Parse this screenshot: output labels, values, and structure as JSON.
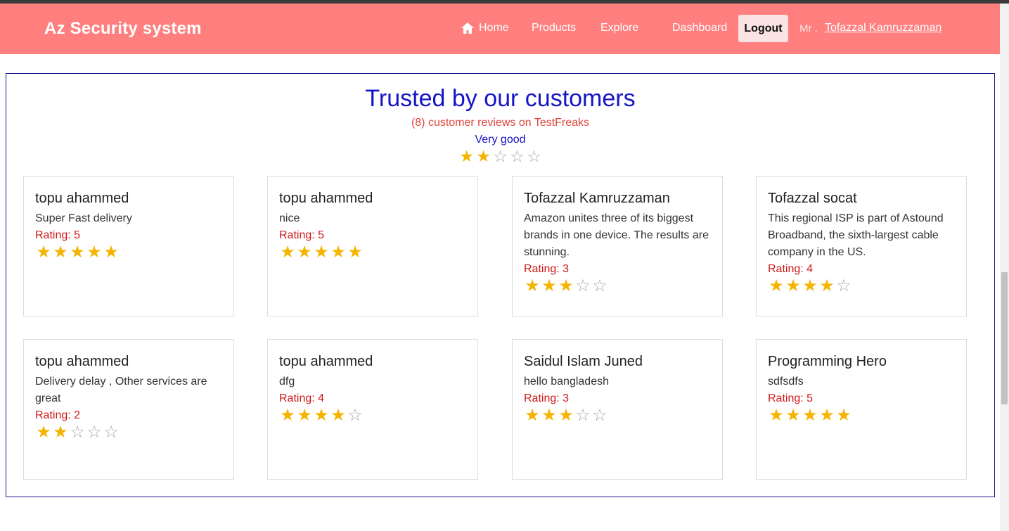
{
  "nav": {
    "brand": "Az Security system",
    "home": "Home",
    "products": "Products",
    "explore": "Explore",
    "dashboard": "Dashboard",
    "logout": "Logout",
    "user_prefix": "Mr .",
    "user_name": "Tofazzal Kamruzzaman"
  },
  "section": {
    "title": "Trusted by our customers",
    "subtitle": "(8) customer reviews on TestFreaks",
    "verdict": "Very good",
    "overall_rating": 2,
    "max_rating": 5
  },
  "reviews": [
    {
      "name": "topu ahammed",
      "text": "Super Fast delivery",
      "rating_label": "Rating: 5",
      "rating": 5
    },
    {
      "name": "topu ahammed",
      "text": "nice",
      "rating_label": "Rating: 5",
      "rating": 5
    },
    {
      "name": "Tofazzal Kamruzzaman",
      "text": "Amazon unites three of its biggest brands in one device. The results are stunning.",
      "rating_label": "Rating: 3",
      "rating": 3
    },
    {
      "name": "Tofazzal socat",
      "text": "This regional ISP is part of Astound Broadband, the sixth-largest cable company in the US.",
      "rating_label": "Rating: 4",
      "rating": 4
    },
    {
      "name": "topu ahammed",
      "text": "Delivery delay , Other services are great",
      "rating_label": "Rating: 2",
      "rating": 2
    },
    {
      "name": "topu ahammed",
      "text": "dfg",
      "rating_label": "Rating: 4",
      "rating": 4
    },
    {
      "name": "Saidul Islam Juned",
      "text": "hello bangladesh",
      "rating_label": "Rating: 3",
      "rating": 3
    },
    {
      "name": "Programming Hero",
      "text": "sdfsdfs",
      "rating_label": "Rating: 5",
      "rating": 5
    }
  ],
  "colors": {
    "navbar": "#ff7f7f",
    "title": "#1414c8",
    "rating_label": "#d01818",
    "star_full": "#f4b400",
    "star_empty": "#a8a8a8"
  },
  "icons": {
    "home": "home-icon",
    "star_full": "star-filled-icon",
    "star_empty": "star-outline-icon"
  }
}
